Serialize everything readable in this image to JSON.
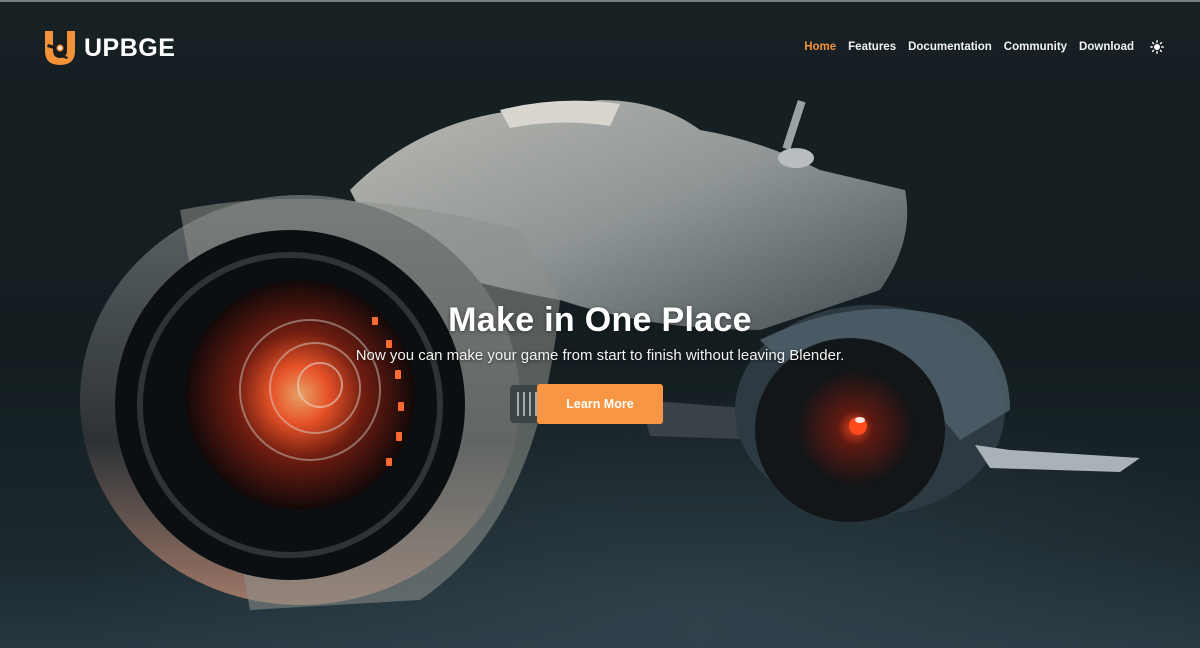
{
  "brand": {
    "name": "UPBGE",
    "logo_icon": "upbge-logo-icon",
    "accent_color": "#f4923a"
  },
  "nav": {
    "items": [
      {
        "label": "Home",
        "active": true
      },
      {
        "label": "Features",
        "active": false
      },
      {
        "label": "Documentation",
        "active": false
      },
      {
        "label": "Community",
        "active": false
      },
      {
        "label": "Download",
        "active": false
      }
    ],
    "theme_toggle_icon": "sun-icon"
  },
  "hero": {
    "title": "Make in One Place",
    "subtitle": "Now you can make your game from start to finish without leaving Blender.",
    "cta_label": "Learn More",
    "cta_color": "#f89643",
    "background_image": "futuristic-hover-bike-render"
  }
}
